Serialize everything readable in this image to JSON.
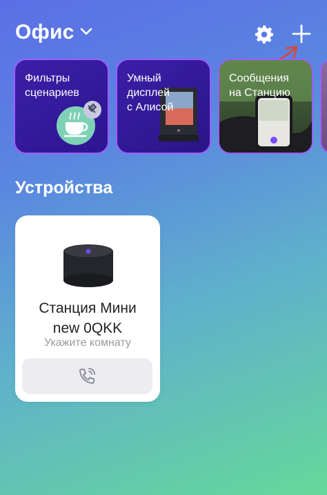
{
  "header": {
    "home_name": "Офис",
    "home_chevron_icon": "chevron-down-icon",
    "settings_icon": "gear-icon",
    "add_icon": "plus-icon"
  },
  "stories": [
    {
      "label": "Фильтры\nсценариев",
      "image": "coffee-cup-pin-icon"
    },
    {
      "label": "Умный\nдисплей\nс Алисой",
      "image": "smart-display-photo"
    },
    {
      "label": "Сообщения\nна Станцию",
      "image": "car-phone-photo"
    },
    {
      "label": "",
      "image": "partial-story-photo"
    }
  ],
  "devices_section": {
    "title": "Устройства"
  },
  "devices": [
    {
      "name": "Станция Мини\nnew 0QKK",
      "room": "Укажите комнату",
      "action_icon": "phone-call-icon"
    }
  ],
  "colors": {
    "story_border": "#a05cff",
    "story_bg": "#3a1f9e",
    "annotation_arrow": "#e0472e"
  }
}
